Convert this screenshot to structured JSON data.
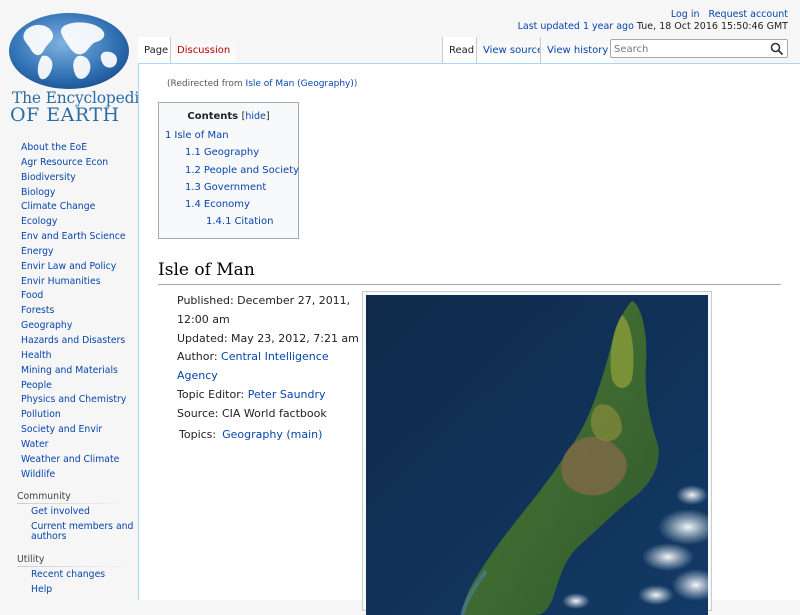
{
  "logo": {
    "line1": "The Encyclopedia",
    "line2": "OF EARTH"
  },
  "sidebar": {
    "main": [
      {
        "label": "About the EoE"
      },
      {
        "label": "Agr Resource Econ"
      },
      {
        "label": "Biodiversity"
      },
      {
        "label": "Biology"
      },
      {
        "label": "Climate Change"
      },
      {
        "label": "Ecology"
      },
      {
        "label": "Env and Earth Science"
      },
      {
        "label": "Energy"
      },
      {
        "label": "Envir Law and Policy"
      },
      {
        "label": "Envir Humanities"
      },
      {
        "label": "Food"
      },
      {
        "label": "Forests"
      },
      {
        "label": "Geography"
      },
      {
        "label": "Hazards and Disasters"
      },
      {
        "label": "Health"
      },
      {
        "label": "Mining and Materials"
      },
      {
        "label": "People"
      },
      {
        "label": "Physics and Chemistry"
      },
      {
        "label": "Pollution"
      },
      {
        "label": "Society and Envir"
      },
      {
        "label": "Water"
      },
      {
        "label": "Weather and Climate"
      },
      {
        "label": "Wildlife"
      }
    ],
    "community": {
      "heading": "Community",
      "items": [
        {
          "label": "Get involved"
        },
        {
          "label": "Current members and authors"
        }
      ]
    },
    "utility": {
      "heading": "Utility",
      "items": [
        {
          "label": "Recent changes"
        },
        {
          "label": "Help"
        }
      ]
    }
  },
  "personal": {
    "login": "Log in",
    "request": "Request account",
    "updated_prefix": "Last updated",
    "updated_ago": "1 year ago",
    "updated_date": "Tue, 18 Oct 2016 15:50:46 GMT"
  },
  "tabs": {
    "page": "Page",
    "discussion": "Discussion",
    "read": "Read",
    "view_source": "View source",
    "view_history": "View history"
  },
  "search": {
    "placeholder": "Search"
  },
  "redirect": {
    "prefix": "(Redirected from ",
    "link": "Isle of Man (Geography)",
    "suffix": ")"
  },
  "toc": {
    "title": "Contents",
    "hide_open": "[",
    "hide": "hide",
    "hide_close": "]",
    "items": [
      {
        "num": "1",
        "label": "Isle of Man"
      },
      {
        "num": "1.1",
        "label": "Geography"
      },
      {
        "num": "1.2",
        "label": "People and Society"
      },
      {
        "num": "1.3",
        "label": "Government"
      },
      {
        "num": "1.4",
        "label": "Economy"
      },
      {
        "num": "1.4.1",
        "label": "Citation"
      }
    ]
  },
  "article": {
    "title": "Isle of Man",
    "published": "Published: December 27, 2011, 12:00 am",
    "updated": "Updated: May 23, 2012, 7:21 am",
    "author_label": "Author: ",
    "author": "Central Intelligence Agency",
    "topic_editor_label": "Topic Editor: ",
    "topic_editor": "Peter Saundry",
    "source": "Source: CIA World factbook",
    "topics_label": "Topics:",
    "topics_link": "Geography (main)"
  }
}
